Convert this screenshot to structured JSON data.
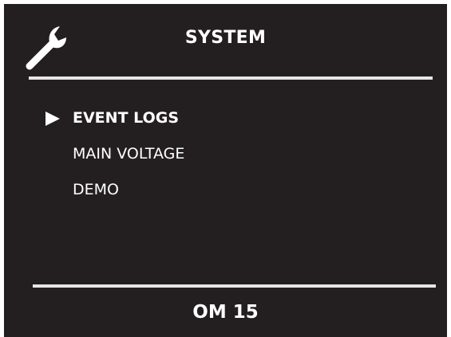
{
  "header": {
    "icon": "wrench-icon",
    "title": "SYSTEM"
  },
  "menu": {
    "selected_index": 0,
    "items": [
      {
        "label": "EVENT LOGS"
      },
      {
        "label": "MAIN VOLTAGE"
      },
      {
        "label": "DEMO"
      }
    ]
  },
  "footer": {
    "label": "OM 15"
  },
  "colors": {
    "background": "#231f20",
    "foreground": "#ffffff",
    "divider": "#e6e6e6"
  }
}
